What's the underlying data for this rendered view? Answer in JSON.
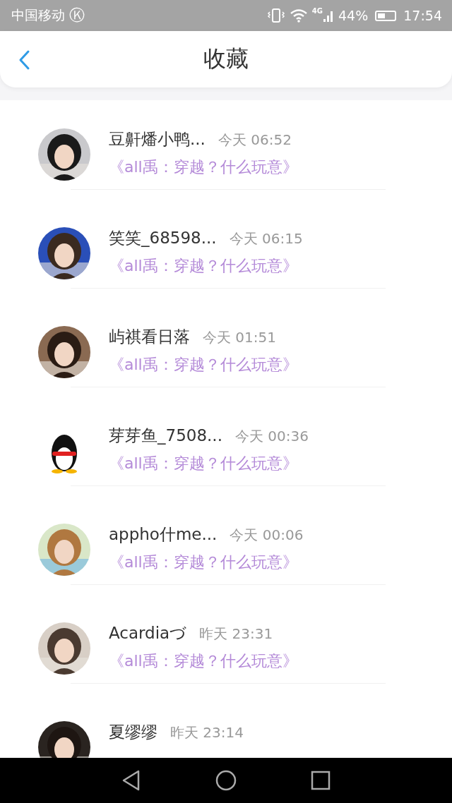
{
  "status_bar": {
    "carrier": "中国移动",
    "carrier_badge": "Ⓚ",
    "network": "4G",
    "battery": "44%",
    "time": "17:54"
  },
  "header": {
    "title": "收藏"
  },
  "favorites": [
    {
      "name": "豆鼾燔小鸭...",
      "time": "今天 06:52",
      "work": "《all禹：穿越？什么玩意》"
    },
    {
      "name": "笑笑_68598...",
      "time": "今天 06:15",
      "work": "《all禹：穿越？什么玩意》"
    },
    {
      "name": "屿祺看日落",
      "time": "今天 01:51",
      "work": "《all禹：穿越？什么玩意》"
    },
    {
      "name": "芽芽鱼_7508...",
      "time": "今天 00:36",
      "work": "《all禹：穿越？什么玩意》"
    },
    {
      "name": "appho什me...",
      "time": "今天 00:06",
      "work": "《all禹：穿越？什么玩意》"
    },
    {
      "name": "Acardiaづ",
      "time": "昨天 23:31",
      "work": "《all禹：穿越？什么玩意》"
    },
    {
      "name": "夏缪缪",
      "time": "昨天 23:14"
    }
  ]
}
